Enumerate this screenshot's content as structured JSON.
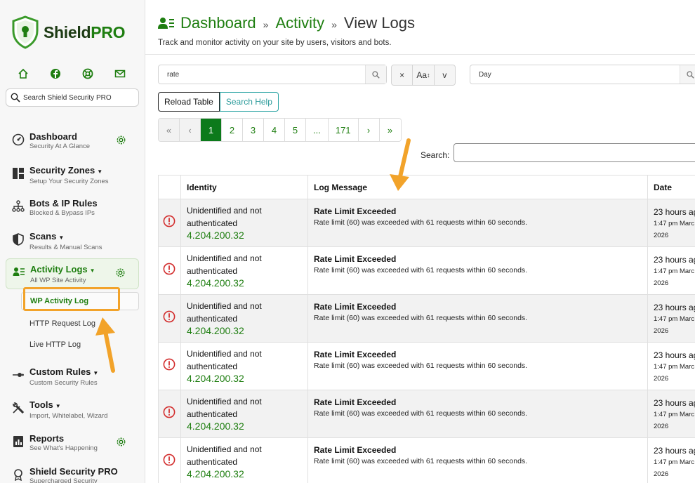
{
  "brand": {
    "name_prefix": "Shield",
    "name_suffix": "PRO"
  },
  "sidebar": {
    "search_placeholder": "Search Shield Security PRO",
    "items": [
      {
        "title": "Dashboard",
        "sub": "Security At A Glance"
      },
      {
        "title": "Security Zones",
        "sub": "Setup Your Security Zones"
      },
      {
        "title": "Bots & IP Rules",
        "sub": "Blocked & Bypass IPs"
      },
      {
        "title": "Scans",
        "sub": "Results & Manual Scans"
      },
      {
        "title": "Activity Logs",
        "sub": "All WP Site Activity"
      },
      {
        "title": "Custom Rules",
        "sub": "Custom Security Rules"
      },
      {
        "title": "Tools",
        "sub": "Import, Whitelabel, Wizard"
      },
      {
        "title": "Reports",
        "sub": "See What's Happening"
      },
      {
        "title": "Shield Security PRO",
        "sub": "Supercharged Security"
      }
    ],
    "subitems": [
      "WP Activity Log",
      "HTTP Request Log",
      "Live HTTP Log"
    ]
  },
  "header": {
    "crumb1": "Dashboard",
    "crumb2": "Activity",
    "current": "View Logs",
    "sep": "»",
    "subtitle": "Track and monitor activity on your site by users, visitors and bots."
  },
  "filters": {
    "search_value": "rate",
    "clear": "×",
    "case": "Aa",
    "toggle": "v",
    "date_value": "Day"
  },
  "buttons": {
    "reload": "Reload Table",
    "help": "Search Help"
  },
  "pagination": [
    "«",
    "‹",
    "1",
    "2",
    "3",
    "4",
    "5",
    "...",
    "171",
    "›",
    "»"
  ],
  "search_label": "Search:",
  "table": {
    "headers": {
      "identity": "Identity",
      "message": "Log Message",
      "date": "Date"
    },
    "rows": [
      {
        "ident": "Unidentified and not authenticated",
        "ip": "4.204.200.32",
        "title": "Rate Limit Exceeded",
        "body": "Rate limit (60) was exceeded with 61 requests within 60 seconds.",
        "date1": "23 hours ag",
        "date2": "1:47 pm Marc",
        "date3": "2026"
      },
      {
        "ident": "Unidentified and not authenticated",
        "ip": "4.204.200.32",
        "title": "Rate Limit Exceeded",
        "body": "Rate limit (60) was exceeded with 61 requests within 60 seconds.",
        "date1": "23 hours ag",
        "date2": "1:47 pm Marc",
        "date3": "2026"
      },
      {
        "ident": "Unidentified and not authenticated",
        "ip": "4.204.200.32",
        "title": "Rate Limit Exceeded",
        "body": "Rate limit (60) was exceeded with 61 requests within 60 seconds.",
        "date1": "23 hours ag",
        "date2": "1:47 pm Marc",
        "date3": "2026"
      },
      {
        "ident": "Unidentified and not authenticated",
        "ip": "4.204.200.32",
        "title": "Rate Limit Exceeded",
        "body": "Rate limit (60) was exceeded with 61 requests within 60 seconds.",
        "date1": "23 hours ag",
        "date2": "1:47 pm Marc",
        "date3": "2026"
      },
      {
        "ident": "Unidentified and not authenticated",
        "ip": "4.204.200.32",
        "title": "Rate Limit Exceeded",
        "body": "Rate limit (60) was exceeded with 61 requests within 60 seconds.",
        "date1": "23 hours ag",
        "date2": "1:47 pm Marc",
        "date3": "2026"
      },
      {
        "ident": "Unidentified and not authenticated",
        "ip": "4.204.200.32",
        "title": "Rate Limit Exceeded",
        "body": "Rate limit (60) was exceeded with 61 requests within 60 seconds.",
        "date1": "23 hours ag",
        "date2": "1:47 pm Marc",
        "date3": "2026"
      }
    ]
  },
  "colors": {
    "brand_green": "#1e7e10",
    "active_page": "#0c7a1b",
    "annotation_orange": "#f2a32a",
    "error_red": "#d32f2f"
  }
}
